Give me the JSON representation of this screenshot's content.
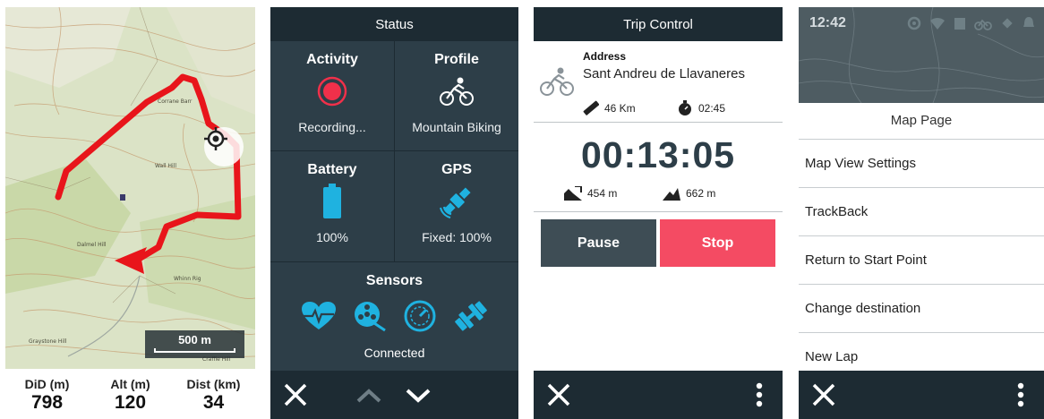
{
  "screen_map": {
    "place_labels": [
      "Wall Hill",
      "Dalmel Hill",
      "Graystone Hill",
      "Whinn Rig",
      "Craffie Hill"
    ],
    "scale_label": "500 m",
    "stats": [
      {
        "label": "DiD (m)",
        "value": "798"
      },
      {
        "label": "Alt (m)",
        "value": "120"
      },
      {
        "label": "Dist (km)",
        "value": "34"
      }
    ],
    "icons": {
      "locate": "crosshair-icon",
      "position": "position-arrow-icon"
    },
    "colors": {
      "track": "#e8151b",
      "position_arrow": "#e8151b"
    }
  },
  "screen_status": {
    "header": "Status",
    "activity": {
      "title": "Activity",
      "value": "Recording..."
    },
    "profile": {
      "title": "Profile",
      "value": "Mountain Biking"
    },
    "battery": {
      "title": "Battery",
      "value": "100%"
    },
    "gps": {
      "title": "GPS",
      "value": "Fixed: 100%"
    },
    "sensors": {
      "title": "Sensors",
      "value": "Connected"
    },
    "colors": {
      "accent": "#1fb2e0",
      "record": "#f0304a",
      "background": "#2d3e48"
    }
  },
  "screen_trip": {
    "header": "Trip Control",
    "address_label": "Address",
    "address_value": "Sant Andreu de Llavaneres",
    "distance_remaining": "46 Km",
    "time_remaining": "02:45",
    "elapsed_time": "00:13:05",
    "descent": "454 m",
    "ascent": "662 m",
    "pause_label": "Pause",
    "stop_label": "Stop",
    "colors": {
      "stop": "#f44b63",
      "pause": "#3e4d55"
    }
  },
  "screen_menu": {
    "clock": "12:42",
    "title": "Map Page",
    "items": [
      "Map View Settings",
      "TrackBack",
      "Return to Start Point",
      "Change destination",
      "New Lap"
    ]
  }
}
